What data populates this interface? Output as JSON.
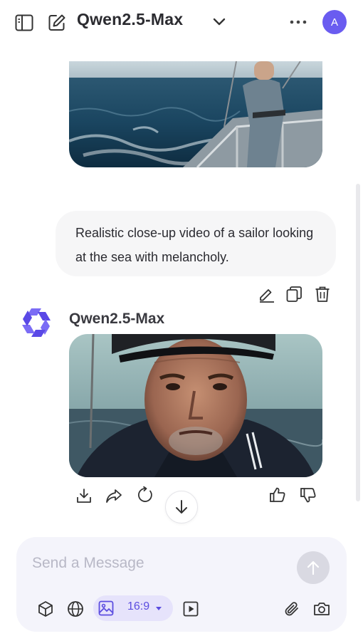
{
  "header": {
    "model_title": "Qwen2.5-Max",
    "avatar_initial": "A",
    "accent": "#6a5cf0"
  },
  "chat": {
    "user_message": "Realistic close-up video of a sailor looking at the sea with melancholy.",
    "assistant_name": "Qwen2.5-Max"
  },
  "composer": {
    "placeholder": "Send a Message",
    "aspect_ratio": "16:9"
  },
  "icons": {
    "header": [
      "sidebar-toggle-icon",
      "new-chat-icon",
      "chevron-down-icon",
      "more-icon"
    ],
    "message_actions": [
      "edit-icon",
      "copy-icon",
      "delete-icon"
    ],
    "response_actions": [
      "download-icon",
      "share-icon",
      "regenerate-icon",
      "thumbs-up-icon",
      "thumbs-down-icon"
    ],
    "composer_tools": [
      "cube-icon",
      "globe-icon",
      "image-icon",
      "video-icon",
      "attach-icon",
      "camera-icon",
      "send-arrow-icon"
    ]
  }
}
